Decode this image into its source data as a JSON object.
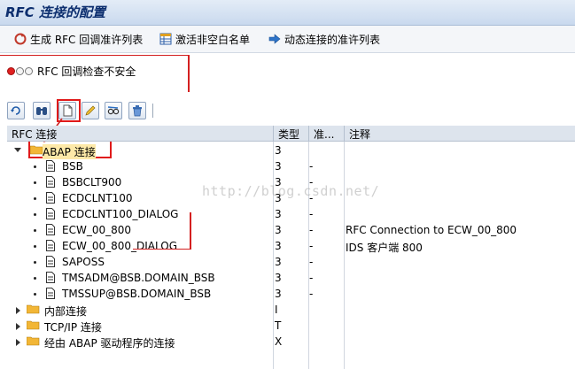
{
  "window": {
    "title": "RFC 连接的配置"
  },
  "appbar": {
    "buttons": [
      {
        "label": "生成 RFC 回调准许列表"
      },
      {
        "label": "激活非空白名单"
      },
      {
        "label": "动态连接的准许列表"
      }
    ]
  },
  "status": {
    "text": "RFC 回调检查不安全"
  },
  "toolbar": {
    "buttons": [
      {
        "icon": "refresh-icon"
      },
      {
        "icon": "find-icon"
      },
      {
        "icon": "create-icon"
      },
      {
        "icon": "edit-icon"
      },
      {
        "icon": "glasses-icon"
      },
      {
        "icon": "delete-icon"
      }
    ]
  },
  "table": {
    "headers": {
      "name": "RFC 连接",
      "type": "类型",
      "access": "准...",
      "comment": "注释"
    },
    "group_abap": {
      "label": "ABAP 连接",
      "type": "3"
    },
    "rows": [
      {
        "name": "BSB",
        "type": "3",
        "access": "-",
        "comment": ""
      },
      {
        "name": "BSBCLT900",
        "type": "3",
        "access": "-",
        "comment": ""
      },
      {
        "name": "ECDCLNT100",
        "type": "3",
        "access": "-",
        "comment": ""
      },
      {
        "name": "ECDCLNT100_DIALOG",
        "type": "3",
        "access": "-",
        "comment": ""
      },
      {
        "name": "ECW_00_800",
        "type": "3",
        "access": "-",
        "comment": "RFC Connection to ECW_00_800"
      },
      {
        "name": "ECW_00_800_DIALOG",
        "type": "3",
        "access": "-",
        "comment": "IDS 客户端 800"
      },
      {
        "name": "SAPOSS",
        "type": "3",
        "access": "-",
        "comment": ""
      },
      {
        "name": "TMSADM@BSB.DOMAIN_BSB",
        "type": "3",
        "access": "-",
        "comment": ""
      },
      {
        "name": "TMSSUP@BSB.DOMAIN_BSB",
        "type": "3",
        "access": "-",
        "comment": ""
      }
    ],
    "groups": [
      {
        "label": "内部连接",
        "type": "I"
      },
      {
        "label": "TCP/IP 连接",
        "type": "T"
      },
      {
        "label": "经由 ABAP 驱动程序的连接",
        "type": "X"
      }
    ]
  },
  "watermark": "http://blog.csdn.net/"
}
